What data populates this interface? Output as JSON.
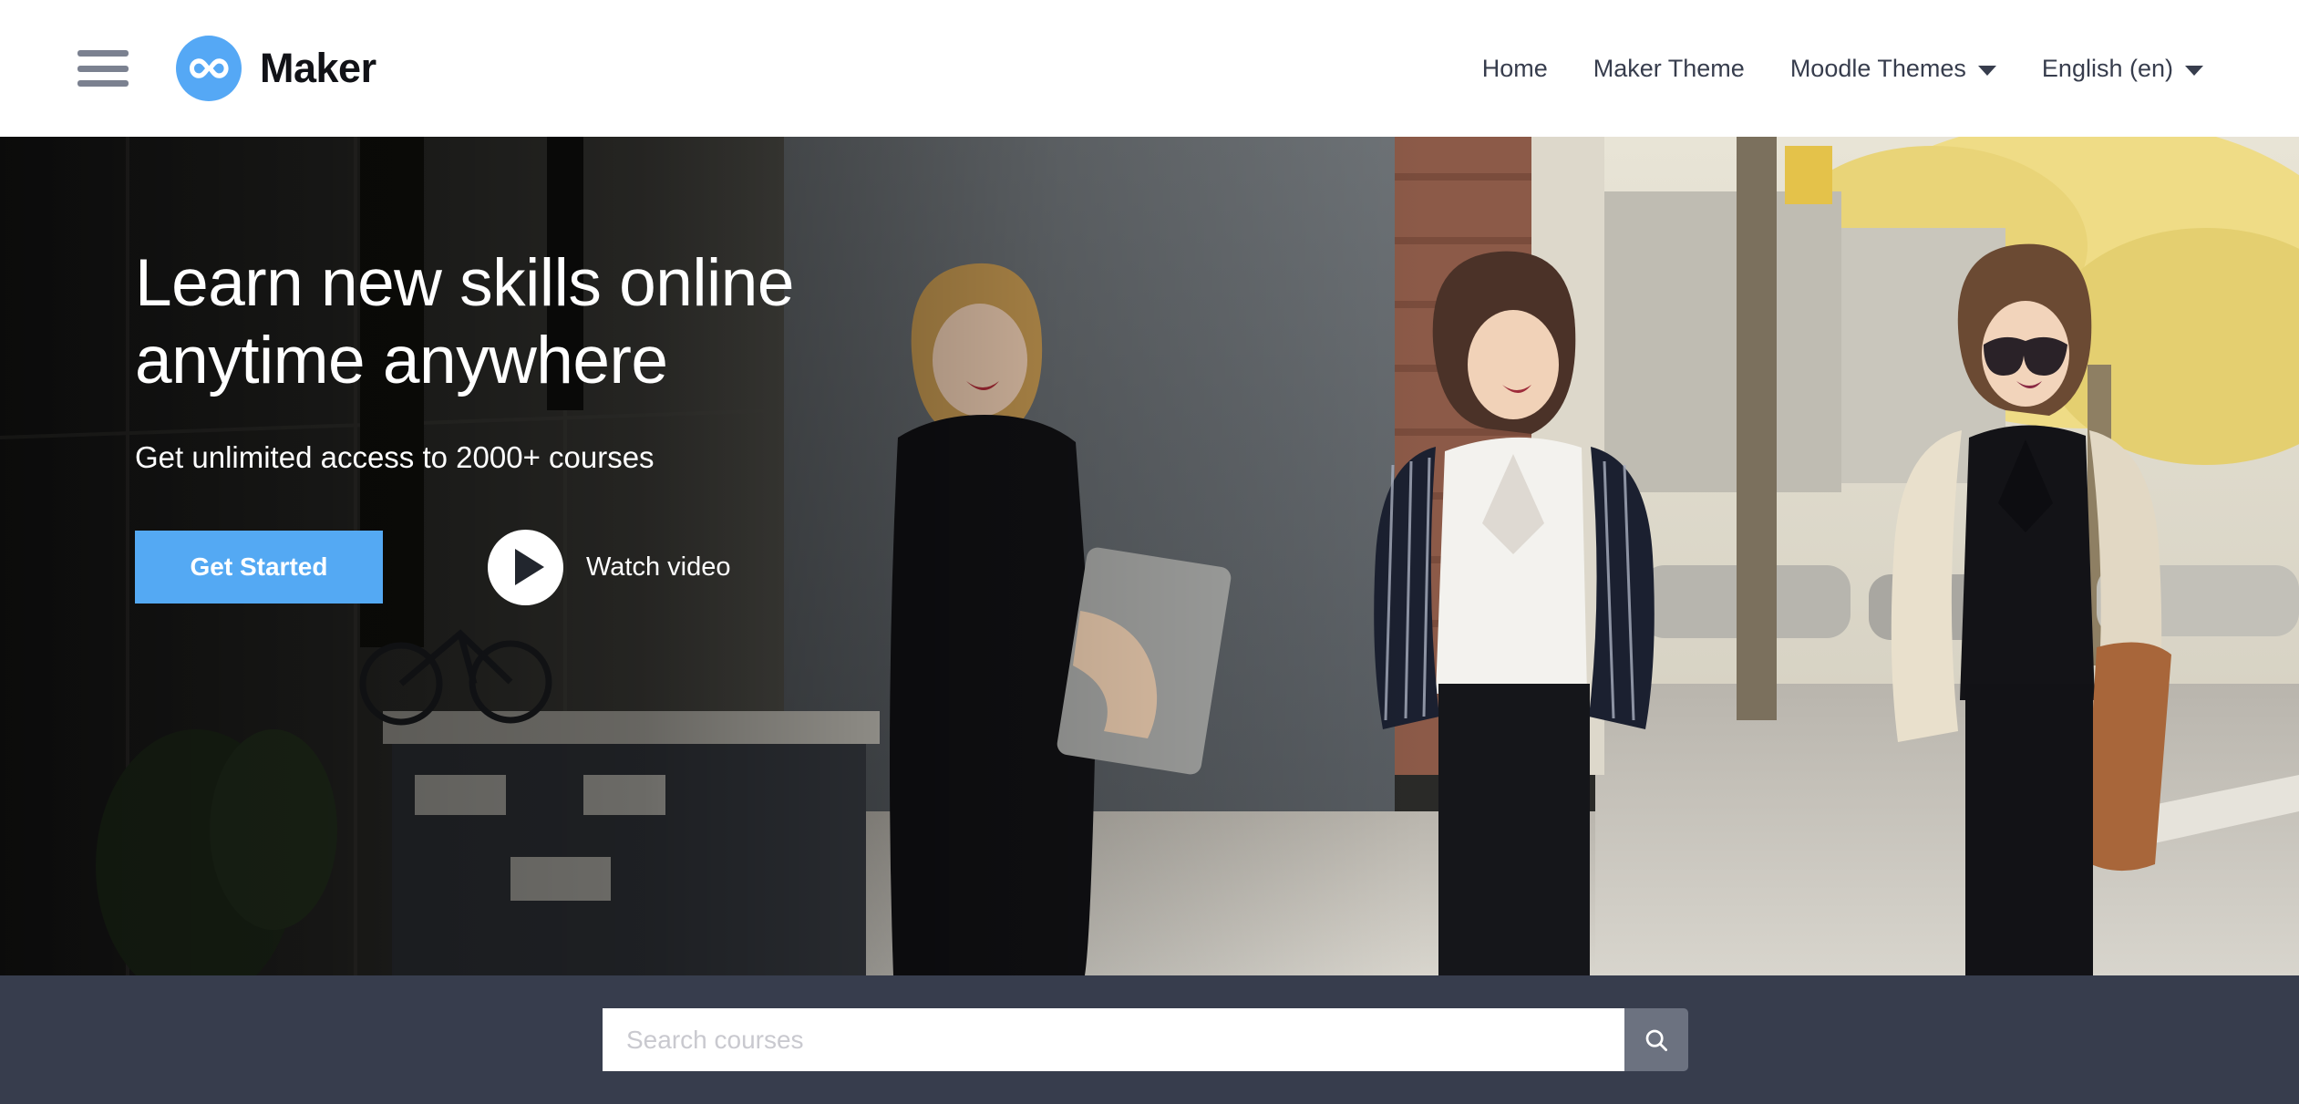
{
  "header": {
    "menu_icon": "hamburger-icon",
    "brand": {
      "logo_icon": "infinity-logo-icon",
      "name": "Maker",
      "color": "#55a8f5"
    },
    "nav": [
      {
        "label": "Home",
        "has_caret": false
      },
      {
        "label": "Maker Theme",
        "has_caret": false
      },
      {
        "label": "Moodle Themes",
        "has_caret": true
      },
      {
        "label": "English (en)",
        "has_caret": true
      }
    ]
  },
  "hero": {
    "title_line1": "Learn new skills online",
    "title_line2": "anytime anywhere",
    "subtitle": "Get unlimited access to 2000+ courses",
    "cta_label": "Get Started",
    "cta_color": "#54a9f3",
    "watch_label": "Watch video",
    "play_icon": "play-icon"
  },
  "search": {
    "placeholder": "Search courses",
    "value": "",
    "button_icon": "search-icon",
    "bar_color": "#373d4d",
    "button_color": "#6c7280"
  }
}
